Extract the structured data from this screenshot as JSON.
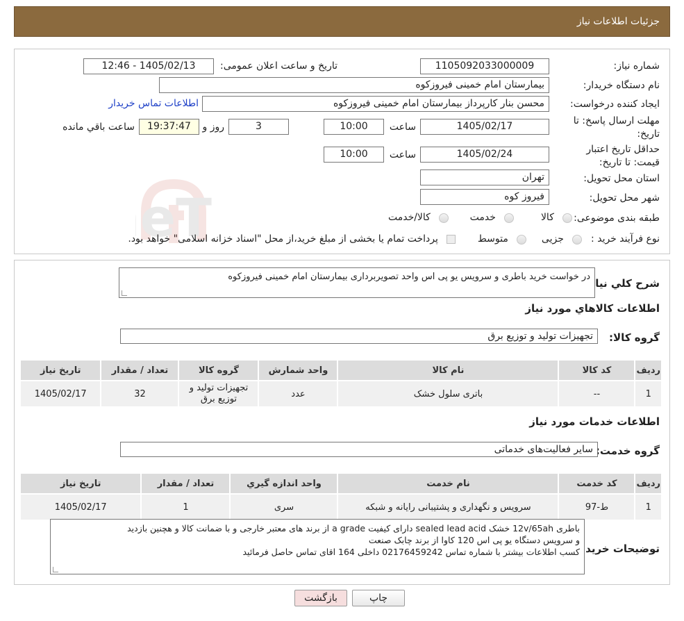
{
  "header": {
    "title": "جزئیات اطلاعات نیاز"
  },
  "form": {
    "need_number_label": "شماره نیاز:",
    "need_number": "1105092033000009",
    "announce_label": "تاریخ و ساعت اعلان عمومی:",
    "announce_value": "1405/02/13 - 12:46",
    "buyer_org_label": "نام دستگاه خریدار:",
    "buyer_org": "بیمارستان امام خمینی فیروزکوه",
    "creator_label": "ایجاد کننده درخواست:",
    "creator": "محسن بنار کارپرداز بیمارستان امام خمینی فیروزکوه",
    "buyer_contact_link": "اطلاعات تماس خریدار",
    "deadline_label": "مهلت ارسال پاسخ: تا تاریخ:",
    "deadline_date": "1405/02/17",
    "time_label": "ساعت",
    "deadline_time": "10:00",
    "days_value": "3",
    "days_label": "روز و",
    "remaining_time": "19:37:47",
    "remaining_label": "ساعت باقي مانده",
    "validity_label": "حداقل تاریخ اعتبار قیمت: تا تاریخ:",
    "validity_date": "1405/02/24",
    "validity_time": "10:00",
    "province_label": "استان محل تحویل:",
    "province": "تهران",
    "city_label": "شهر محل تحویل:",
    "city": "فیروز کوه",
    "category_label": "طبقه بندی موضوعی:",
    "category_options": [
      "کالا",
      "خدمت",
      "کالا/خدمت"
    ],
    "process_label": "نوع فرآیند خرید :",
    "process_options": [
      "جزیی",
      "متوسط"
    ],
    "payment_note": "پرداخت تمام یا بخشی از مبلغ خرید،از محل \"اسناد خزانه اسلامی\" خواهد بود."
  },
  "summary": {
    "label": "شرح کلي نياز:",
    "text": "در خواست خرید باطری و سرویس یو پی  اس واحد تصویربرداری بیمارستان امام خمینی فیروزکوه"
  },
  "goods": {
    "title": "اطلاعات کالاهاي مورد نياز",
    "group_label": "گروه کالا:",
    "group_value": "تجهیزات تولید و توزیع برق",
    "columns": [
      "رديف",
      "کد کالا",
      "نام کالا",
      "واحد شمارش",
      "گروه کالا",
      "تعداد / مقدار",
      "تاريخ نياز"
    ],
    "rows": [
      [
        "1",
        "--",
        "باتری سلول خشک",
        "عدد",
        "تجهیزات تولید و توزیع برق",
        "32",
        "1405/02/17"
      ]
    ]
  },
  "services": {
    "title": "اطلاعات خدمات مورد نياز",
    "group_label": "گروه خدمت:",
    "group_value": "سایر فعالیت‌های خدماتی",
    "columns": [
      "رديف",
      "کد خدمت",
      "نام خدمت",
      "واحد اندازه گيري",
      "تعداد / مقدار",
      "تاريخ نياز"
    ],
    "rows": [
      [
        "1",
        "ط-97",
        "سرویس و نگهداری و پشتیبانی رایانه و شبکه",
        "سری",
        "1",
        "1405/02/17"
      ]
    ]
  },
  "buyer_notes": {
    "label": "توضیحات خریدار:",
    "lines": [
      "باطری 12v/65ah خشک sealed lead acid دارای کیفیت a grade  از برند های معتبر خارجی  و با ضمانت کالا و هچنین بازدید",
      "و سرویس دستگاه یو پی اس 120 کاوا از برند چابک صنعت",
      "کسب اطلاعات بیشتر با شماره تماس 02176459242 داخلی 164 اقای   تماس حاصل فرمائید"
    ]
  },
  "buttons": {
    "print": "چاپ",
    "back": "بازگشت"
  },
  "colors": {
    "header": "#8b6a3e",
    "back_button": "#f6dede",
    "link": "#1d3fc7"
  },
  "watermark": {
    "text": "AriaTender.neT"
  }
}
